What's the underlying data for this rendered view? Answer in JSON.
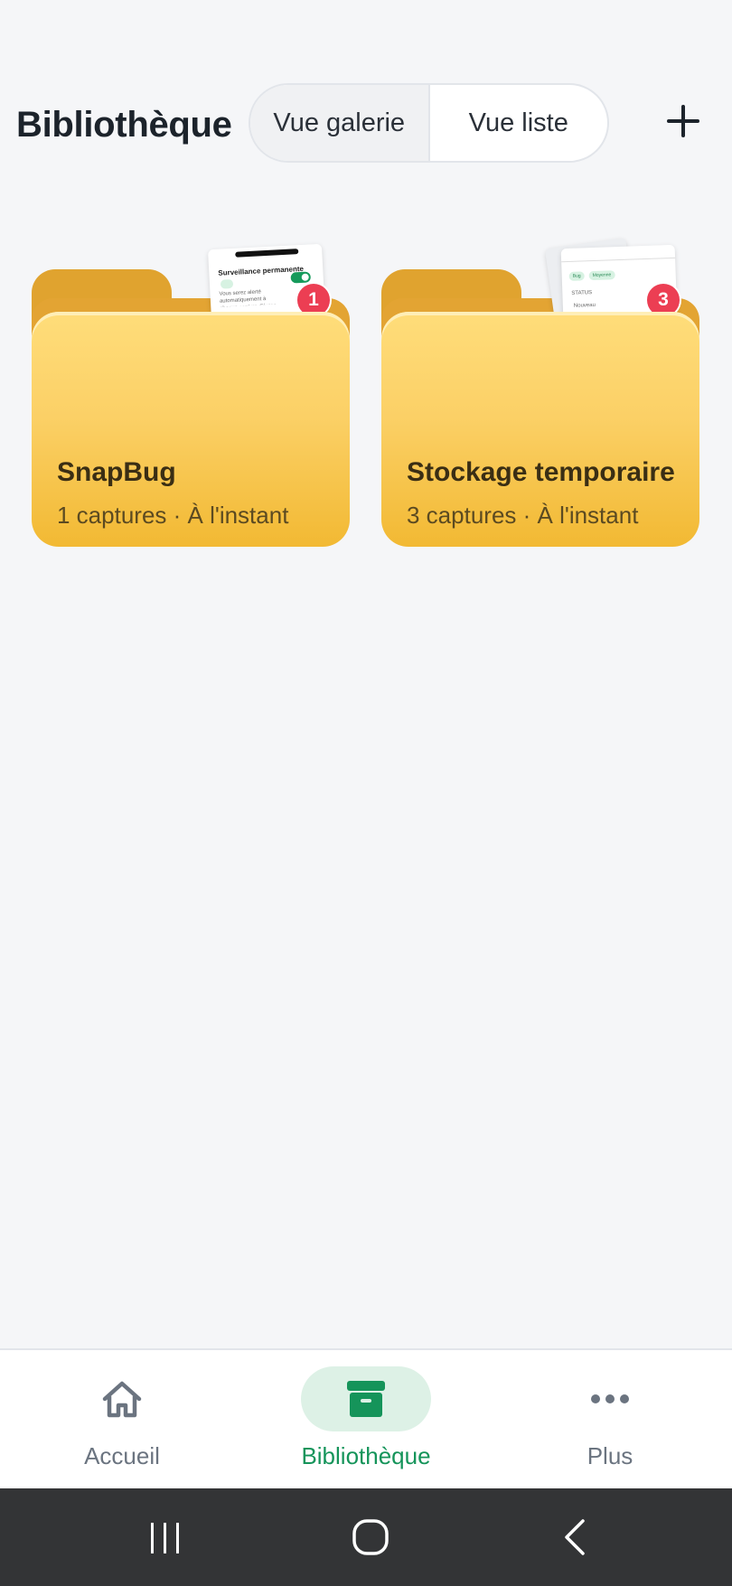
{
  "header": {
    "title": "Bibliothèque",
    "view_gallery": "Vue galerie",
    "view_list": "Vue liste",
    "add_icon": "plus-icon"
  },
  "folders": [
    {
      "name": "SnapBug",
      "meta": "1 captures · À l'instant",
      "badge": "1",
      "preview_title": "Surveillance permanente",
      "preview_text": "Vous serez alerté automatiquement à chaque capture d'écran"
    },
    {
      "name": "Stockage temporaire",
      "meta": "3 captures · À l'instant",
      "badge": "3",
      "preview_chip1": "Bug",
      "preview_chip2": "Moyenne",
      "preview_label": "STATUS",
      "preview_value": "Nouveau"
    }
  ],
  "bottom_nav": {
    "items": [
      {
        "label": "Accueil",
        "icon": "home-icon"
      },
      {
        "label": "Bibliothèque",
        "icon": "archive-box-icon",
        "active": true
      },
      {
        "label": "Plus",
        "icon": "more-dots-icon"
      }
    ]
  },
  "colors": {
    "accent": "#15945a",
    "badge": "#ec3e53",
    "folder": "#f2b933"
  }
}
